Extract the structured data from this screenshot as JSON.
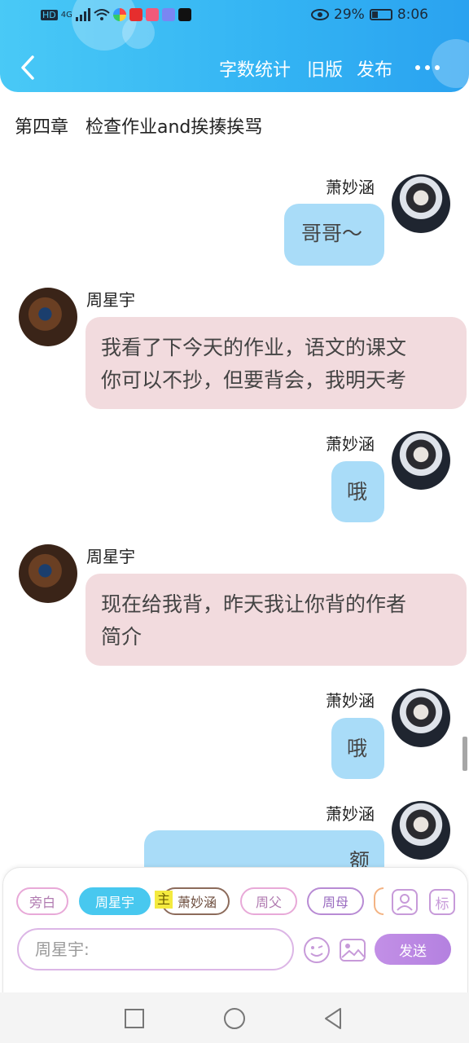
{
  "status_bar": {
    "left_labels": [
      "HD",
      "4G"
    ],
    "battery_percent": "29%",
    "battery_level": 0.29,
    "time": "8:06"
  },
  "header": {
    "back_icon": "chevron-left-icon",
    "word_count": "字数统计",
    "old_version": "旧版",
    "publish": "发布",
    "more_icon": "more-dots-icon",
    "gradient": [
      "#49c9f6",
      "#2aa2f0"
    ]
  },
  "chapter_title": "第四章   检查作业and挨揍挨骂",
  "messages": [
    {
      "side": "right",
      "name": "萧妙涵",
      "text": "哥哥～"
    },
    {
      "side": "left",
      "name": "周星宇",
      "lines": [
        "我看了下今天的作业，语文的课文",
        "你可以不抄，但要背会，我明天考"
      ]
    },
    {
      "side": "right",
      "name": "萧妙涵",
      "text": "哦"
    },
    {
      "side": "left",
      "name": "周星宇",
      "lines": [
        "现在给我背，昨天我让你背的作者",
        "简介"
      ]
    },
    {
      "side": "right",
      "name": "萧妙涵",
      "text": "哦"
    },
    {
      "side": "right",
      "name": "萧妙涵",
      "text": "额"
    }
  ],
  "composer": {
    "chips": [
      "旁白",
      "周星宇",
      "萧妙涵",
      "周父",
      "周母"
    ],
    "main_tag": "主",
    "mark_button": "标",
    "input_placeholder": "周星宇:",
    "send": "发送",
    "colors": {
      "active_chip": "#48c8ef",
      "send": "#b481e0",
      "right_bubble": "#a9dcf8",
      "left_bubble": "#f2dbde"
    }
  },
  "system_nav": [
    "square-icon",
    "circle-icon",
    "triangle-back-icon"
  ]
}
